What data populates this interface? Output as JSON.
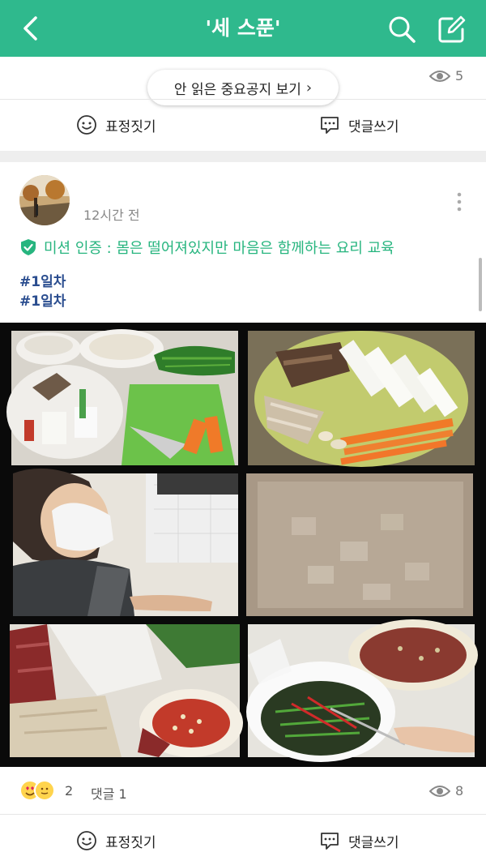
{
  "header": {
    "title": "'세 스푼'",
    "bg_color": "#2fb98d",
    "back_icon": "chevron-left-icon",
    "search_icon": "search-icon",
    "write_icon": "edit-icon"
  },
  "prev_post": {
    "views": "5",
    "notice_pill": "안 읽은 중요공지 보기",
    "react_label": "표정짓기",
    "comment_label": "댓글쓰기"
  },
  "post": {
    "time_ago": "12시간 전",
    "mission": "미션 인증 : 몸은 떨어져있지만 마음은 함께하는 요리 교육",
    "mission_color": "#27b57f",
    "tags": [
      "#1일차",
      "#1일차"
    ],
    "photo_grid": [
      "prep-ingredients-photo",
      "sliced-vegetables-photo",
      "person-cooking-photo",
      "rice-soaking-photo",
      "raw-beef-photo",
      "vegetables-bowl-photo"
    ],
    "reaction_count": "2",
    "comment_count": "댓글 1",
    "views": "8",
    "react_label": "표정짓기",
    "comment_label": "댓글쓰기"
  }
}
